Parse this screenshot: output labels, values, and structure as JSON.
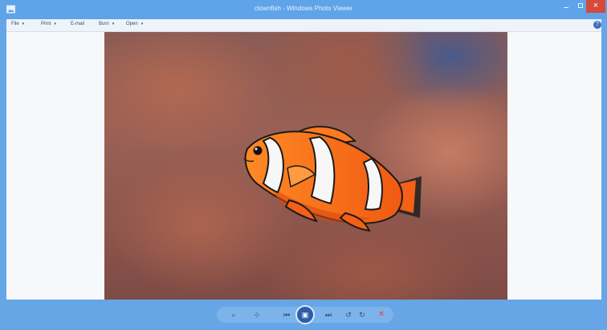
{
  "window": {
    "title": "clownfish - Windows Photo Viewer",
    "close_glyph": "×"
  },
  "menu": {
    "items": [
      {
        "label": "File",
        "caret": "▾"
      },
      {
        "label": "Print",
        "caret": "▾"
      },
      {
        "label": "E-mail",
        "caret": ""
      },
      {
        "label": "Burn",
        "caret": "▾"
      },
      {
        "label": "Open",
        "caret": "▾"
      }
    ],
    "help_glyph": "?"
  },
  "photo": {
    "subject": "clownfish"
  },
  "controls": {
    "zoom": "⌕",
    "actual_size": "⊹",
    "previous": "⏮",
    "slideshow": "▣",
    "next": "⏭",
    "rotate_ccw": "↺",
    "rotate_cw": "↻",
    "delete": "✕"
  },
  "colors": {
    "title_bar": "#5fa3e8",
    "close_button": "#d44a3c",
    "accent": "#2f5ea8"
  }
}
